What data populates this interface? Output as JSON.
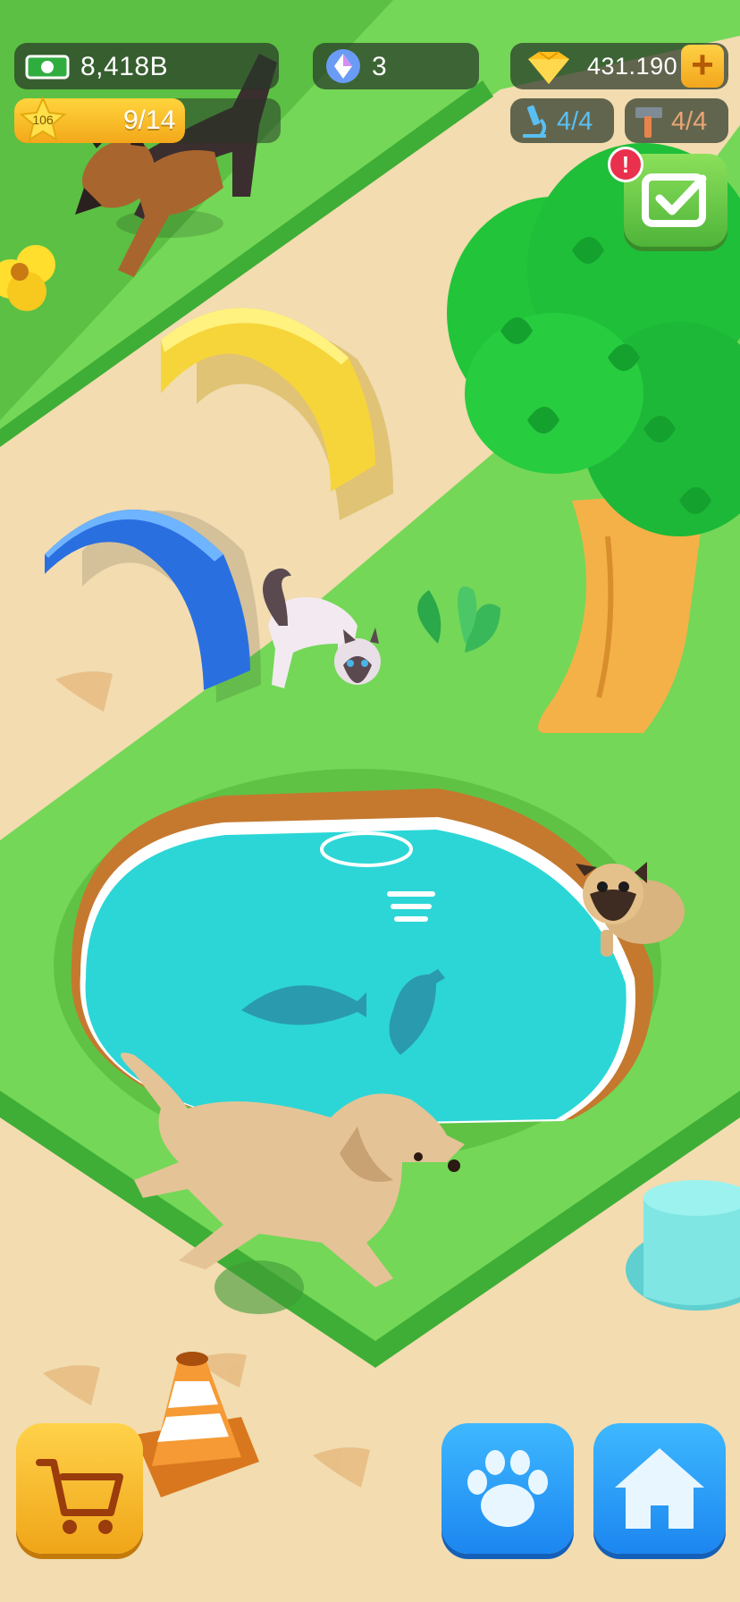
{
  "hud": {
    "cash": {
      "value": "8,418B",
      "icon": "cash-icon"
    },
    "gems": {
      "value": "3",
      "icon": "crystal-orb-icon"
    },
    "diamonds": {
      "value": "431.190",
      "icon": "diamond-icon",
      "add_icon": "plus-icon"
    },
    "level": {
      "star_level": "106",
      "progress_text": "9/14",
      "progress_fraction": 0.64,
      "icon": "star-icon"
    },
    "research": {
      "value": "4/4",
      "icon": "microscope-icon"
    },
    "build": {
      "value": "4/4",
      "icon": "hammer-icon"
    },
    "tasks": {
      "icon": "checkbox-icon",
      "alert": "!"
    }
  },
  "bottom_bar": {
    "shop": {
      "icon": "shopping-cart-icon"
    },
    "pets": {
      "icon": "paw-icon"
    },
    "home": {
      "icon": "house-icon"
    }
  },
  "scene": {
    "animals": [
      "german-shepherd",
      "siamese-cat",
      "pug",
      "golden-retriever"
    ],
    "props": [
      "yellow-arch",
      "blue-arch",
      "pond",
      "tree",
      "traffic-cone",
      "fish-silhouettes"
    ]
  },
  "colors": {
    "grass": "#74d757",
    "path": "#f3dcae",
    "water": "#2fd9d9",
    "accent_yellow": "#f6b21f",
    "accent_blue": "#1f8ef4",
    "accent_green": "#5fc244"
  }
}
